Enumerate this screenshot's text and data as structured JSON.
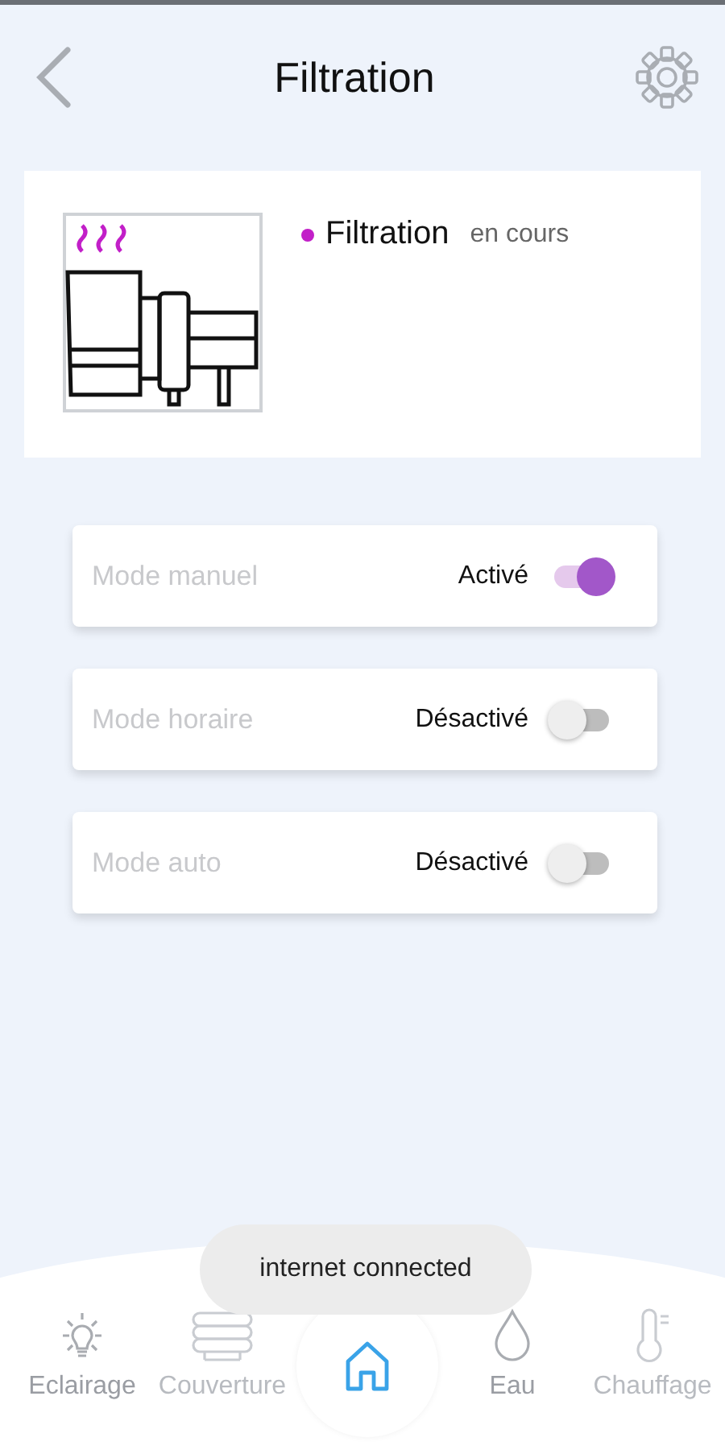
{
  "header": {
    "title": "Filtration"
  },
  "status_card": {
    "name": "Filtration",
    "status": "en cours",
    "color": "#c21fc8"
  },
  "modes": [
    {
      "label": "Mode manuel",
      "state": "Activé",
      "on": true
    },
    {
      "label": "Mode horaire",
      "state": "Désactivé",
      "on": false
    },
    {
      "label": "Mode auto",
      "state": "Désactivé",
      "on": false
    }
  ],
  "toast": "internet connected",
  "nav": [
    {
      "kind": "bulb",
      "label": "Eclairage",
      "selected": false,
      "disabled": false
    },
    {
      "kind": "cover",
      "label": "Couverture",
      "selected": false,
      "disabled": true
    },
    {
      "kind": "home",
      "selected": true,
      "disabled": false
    },
    {
      "kind": "drop",
      "label": "Eau",
      "selected": false,
      "disabled": false
    },
    {
      "kind": "thermo",
      "label": "Chauffage",
      "selected": false,
      "disabled": true
    }
  ]
}
